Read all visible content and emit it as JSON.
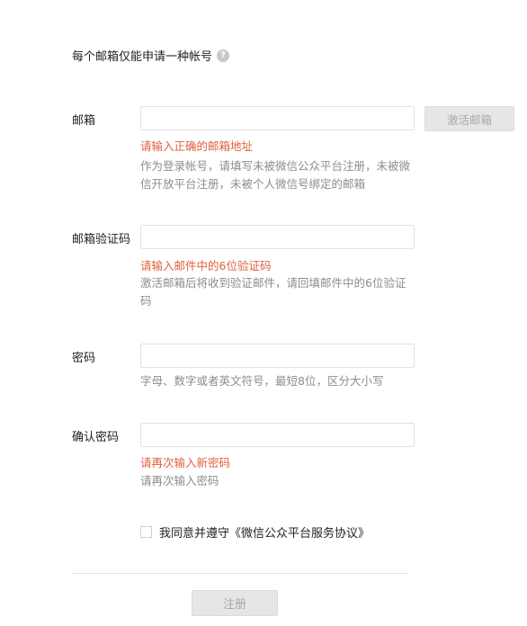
{
  "form": {
    "title": "每个邮箱仅能申请一种帐号",
    "help_icon": "help-question-icon",
    "email": {
      "label": "邮箱",
      "value": "",
      "error": "请输入正确的邮箱地址",
      "tip": "作为登录帐号，请填写未被微信公众平台注册，未被微信开放平台注册，未被个人微信号绑定的邮箱",
      "activate_button": "激活邮箱"
    },
    "verify_code": {
      "label": "邮箱验证码",
      "value": "",
      "error": "请输入邮件中的6位验证码",
      "tip": "激活邮箱后将收到验证邮件，请回填邮件中的6位验证码"
    },
    "password": {
      "label": "密码",
      "value": "",
      "tip": "字母、数字或者英文符号，最短8位，区分大小写"
    },
    "confirm_password": {
      "label": "确认密码",
      "value": "",
      "error": "请再次输入新密码",
      "tip": "请再次输入密码"
    },
    "agreement": {
      "checked": false,
      "text": "我同意并遵守《微信公众平台服务协议》"
    },
    "submit_button": "注册"
  },
  "colors": {
    "error": "#e15f3f",
    "tip": "#8d8d8d",
    "disabled_button_bg": "#e6e6e6"
  }
}
